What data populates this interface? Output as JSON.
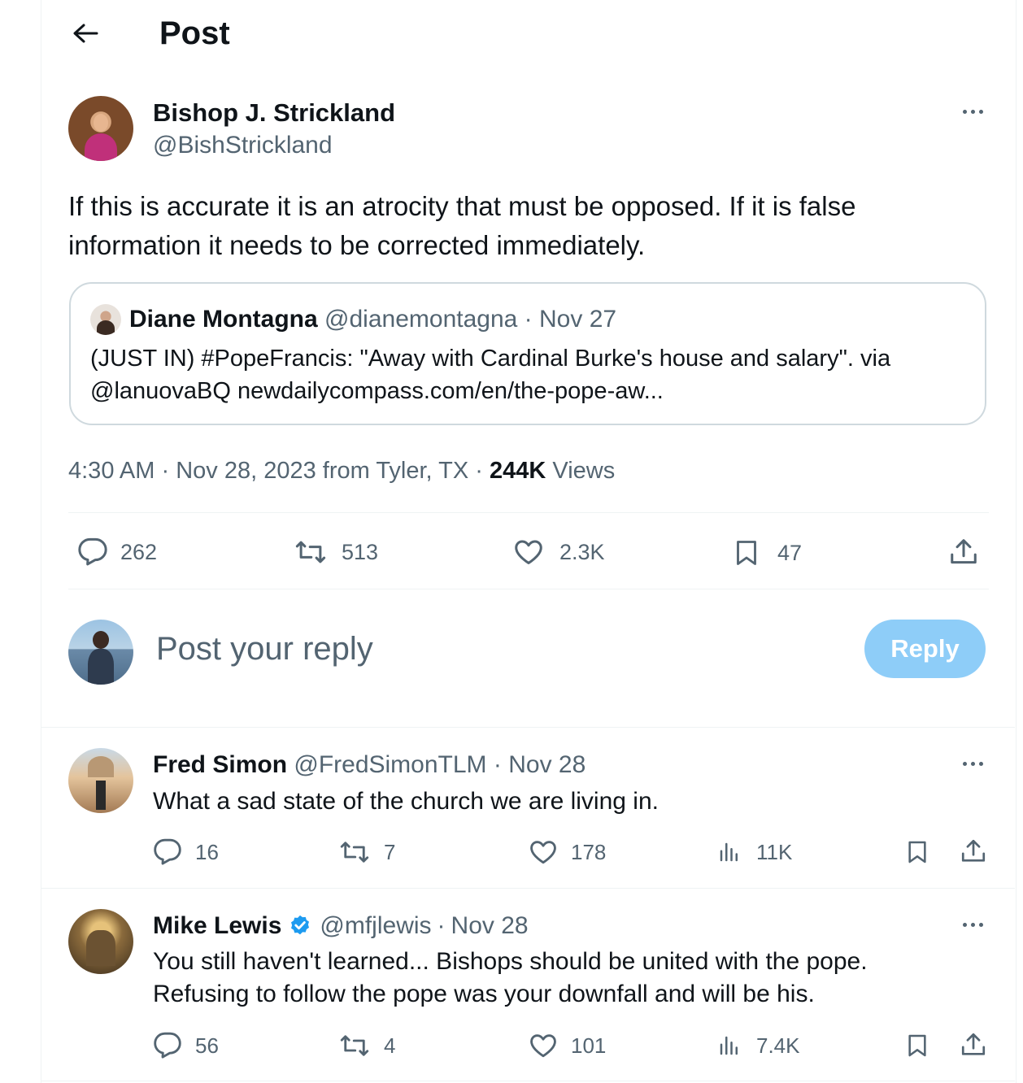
{
  "header": {
    "title": "Post"
  },
  "post": {
    "author_name": "Bishop J. Strickland",
    "author_handle": "@BishStrickland",
    "text_line1": "If this is accurate it is an atrocity that must be opposed. If it is false",
    "text_line2": "information it needs to be corrected immediately.",
    "quote": {
      "name": "Diane Montagna",
      "handle": "@dianemontagna",
      "sep": "·",
      "date": "Nov 27",
      "line1": "(JUST IN) #PopeFrancis: \"Away with Cardinal Burke's house and salary\". via",
      "line2": "@lanuovaBQ newdailycompass.com/en/the-pope-aw..."
    },
    "meta": {
      "time": "4:30 AM",
      "sep": "·",
      "date": "Nov 28, 2023",
      "location": "from Tyler, TX",
      "views_count": "244K",
      "views_label": "Views"
    },
    "stats": {
      "replies": "262",
      "reposts": "513",
      "likes": "2.3K",
      "bookmarks": "47"
    }
  },
  "composer": {
    "placeholder": "Post your reply",
    "button_label": "Reply"
  },
  "replies": [
    {
      "name": "Fred Simon",
      "handle": "@FredSimonTLM",
      "sep": "·",
      "date": "Nov 28",
      "text_line1": "What a sad state of the church we are living in.",
      "replies": "16",
      "reposts": "7",
      "likes": "178",
      "views": "11K"
    },
    {
      "name": "Mike Lewis",
      "handle": "@mfjlewis",
      "sep": "·",
      "date": "Nov 28",
      "verified": true,
      "text_line1": "You still haven't learned... Bishops should be united with the pope.",
      "text_line2": "Refusing to follow the pope was your downfall and will be his.",
      "replies": "56",
      "reposts": "4",
      "likes": "101",
      "views": "7.4K"
    }
  ],
  "colors": {
    "accent": "#1d9bf0",
    "reply_button_disabled": "#8ecdf8",
    "muted": "#536471",
    "border": "#cfd9de"
  }
}
